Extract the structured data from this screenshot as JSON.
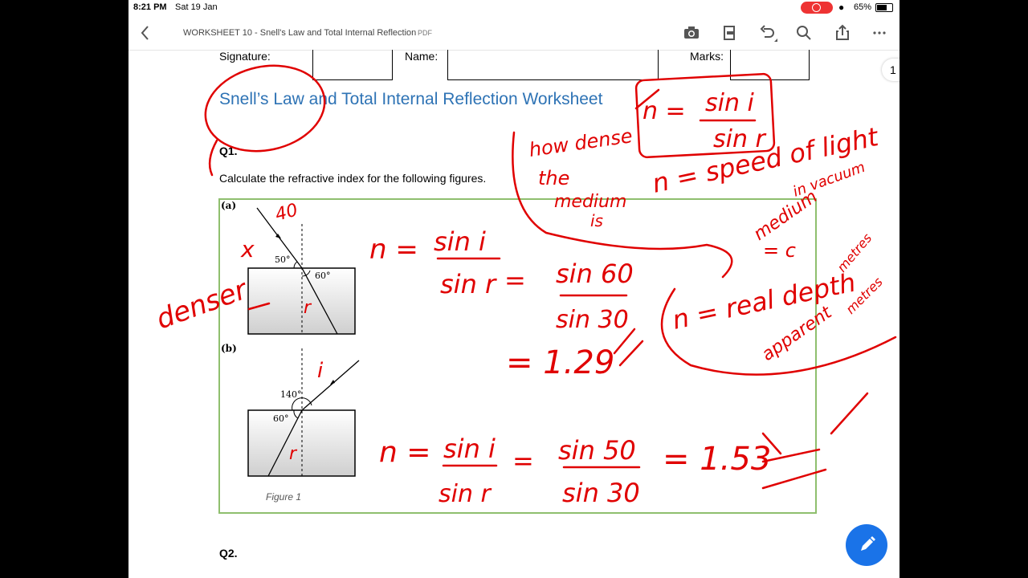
{
  "status_bar": {
    "time": "8:21 PM",
    "date": "Sat 19 Jan",
    "battery": "65%"
  },
  "nav": {
    "title": "WORKSHEET 10 - Snell's Law and Total Internal Reflection",
    "file_type": "PDF"
  },
  "header": {
    "signature": "Signature:",
    "name": "Name:",
    "marks": "Marks:"
  },
  "worksheet_title": "Snell’s Law and Total Internal Reflection Worksheet",
  "q1": {
    "label": "Q1.",
    "text": "Calculate the refractive index for the following figures."
  },
  "figure": {
    "label_a": "(a)",
    "label_b": "(b)",
    "caption": "Figure 1",
    "a_angle1": "50°",
    "a_angle2": "60°",
    "b_angle1": "140°",
    "b_angle2": "60°"
  },
  "q2": {
    "label": "Q2."
  },
  "page_number": "1",
  "ink": {
    "formula_n": "n =",
    "formula_sin_i": "sin i",
    "formula_sin_r": "sin r",
    "note_how_dense": "how dense",
    "note_the": "the",
    "note_medium": "medium",
    "note_is": "is",
    "speed_formula": "n = speed of light",
    "in_vacuum": "in vacuum",
    "medium": "medium",
    "eq_c": "= c",
    "real_depth": "n = real depth",
    "apparent": "apparent",
    "metres1": "metres",
    "metres2": "metres",
    "a_n": "n =",
    "a_sin_i": "sin i",
    "a_sin_r": "sin r",
    "a_eq": "=",
    "a_sin60": "sin 60",
    "a_sin30": "sin 30",
    "a_result": "= 1.29",
    "b_n": "n =",
    "b_sin_i": "sin i",
    "b_sin_r": "sin r",
    "b_eq": "=",
    "b_sin50": "sin 50",
    "b_sin30": "sin 30",
    "b_result": "= 1.53",
    "denser": "denser",
    "x_mark": "x",
    "angle_40": "40",
    "i_mark": "i",
    "r_mark_a": "r",
    "r_mark_b": "r"
  },
  "colors": {
    "ink": "#e00000",
    "title_blue": "#2e73b5",
    "box_green": "#8fbf6e",
    "fab_blue": "#1a73e8"
  }
}
